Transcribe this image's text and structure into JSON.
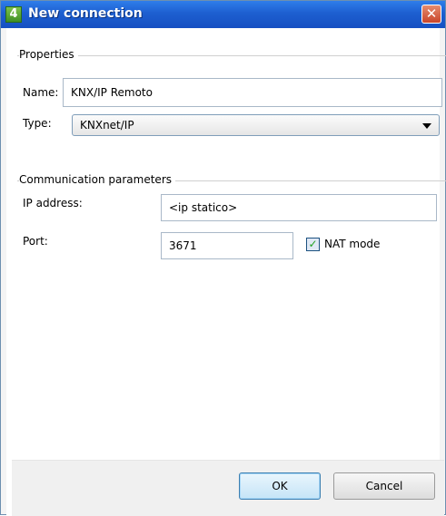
{
  "window": {
    "title": "New connection",
    "app_icon_glyph": "4",
    "close_glyph": "✕"
  },
  "properties": {
    "group_label": "Properties",
    "name_label": "Name:",
    "name_value": "KNX/IP Remoto",
    "type_label": "Type:",
    "type_value": "KNXnet/IP"
  },
  "communication": {
    "group_label": "Communication parameters",
    "ip_label": "IP address:",
    "ip_value": "<ip statico>",
    "port_label": "Port:",
    "port_value": "3671",
    "nat_label": "NAT mode",
    "nat_checked": true,
    "check_glyph": "✓"
  },
  "buttons": {
    "ok": "OK",
    "cancel": "Cancel"
  },
  "colors": {
    "titlebar": "#1d5fd0",
    "close": "#c9452a",
    "accent_check": "#21a121"
  }
}
